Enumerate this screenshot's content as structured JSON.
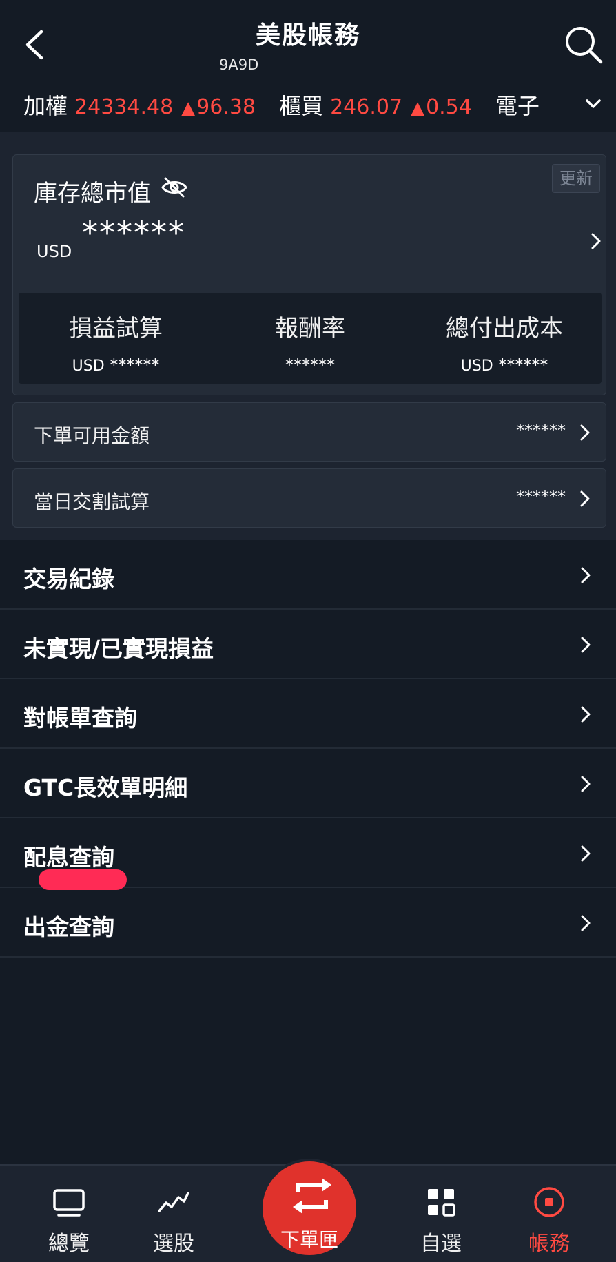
{
  "header": {
    "title": "美股帳務",
    "account_code": "9A9D"
  },
  "ticker": {
    "items": [
      {
        "name": "加權",
        "value": "24334.48",
        "arrow": "▲",
        "change": "96.38"
      },
      {
        "name": "櫃買",
        "value": "246.07",
        "arrow": "▲",
        "change": "0.54"
      },
      {
        "name": "電子",
        "value": "",
        "arrow": "",
        "change": ""
      }
    ],
    "up_color": "#ff4a42"
  },
  "inventory": {
    "title": "庫存總市值",
    "refresh_label": "更新",
    "currency": "USD",
    "market_value": "******",
    "stats": [
      {
        "label": "損益試算",
        "currency": "USD",
        "value": "******"
      },
      {
        "label": "報酬率",
        "currency": "",
        "value": "******"
      },
      {
        "label": "總付出成本",
        "currency": "USD",
        "value": "******"
      }
    ]
  },
  "rows": [
    {
      "label": "下單可用金額",
      "value": "******"
    },
    {
      "label": "當日交割試算",
      "value": "******"
    }
  ],
  "menu": [
    {
      "label": "交易紀錄"
    },
    {
      "label": "未實現/已實現損益"
    },
    {
      "label": "對帳單查詢"
    },
    {
      "label": "GTC長效單明細"
    },
    {
      "label": "配息查詢"
    },
    {
      "label": "出金查詢"
    }
  ],
  "bottom_nav": {
    "items": [
      {
        "label": "總覽",
        "icon": "monitor-icon"
      },
      {
        "label": "選股",
        "icon": "trend-line-icon"
      },
      {
        "label": "下單匣",
        "icon": "swap-arrows-icon"
      },
      {
        "label": "自選",
        "icon": "grid-icon"
      },
      {
        "label": "帳務",
        "icon": "record-circle-icon"
      }
    ],
    "active": "帳務"
  }
}
